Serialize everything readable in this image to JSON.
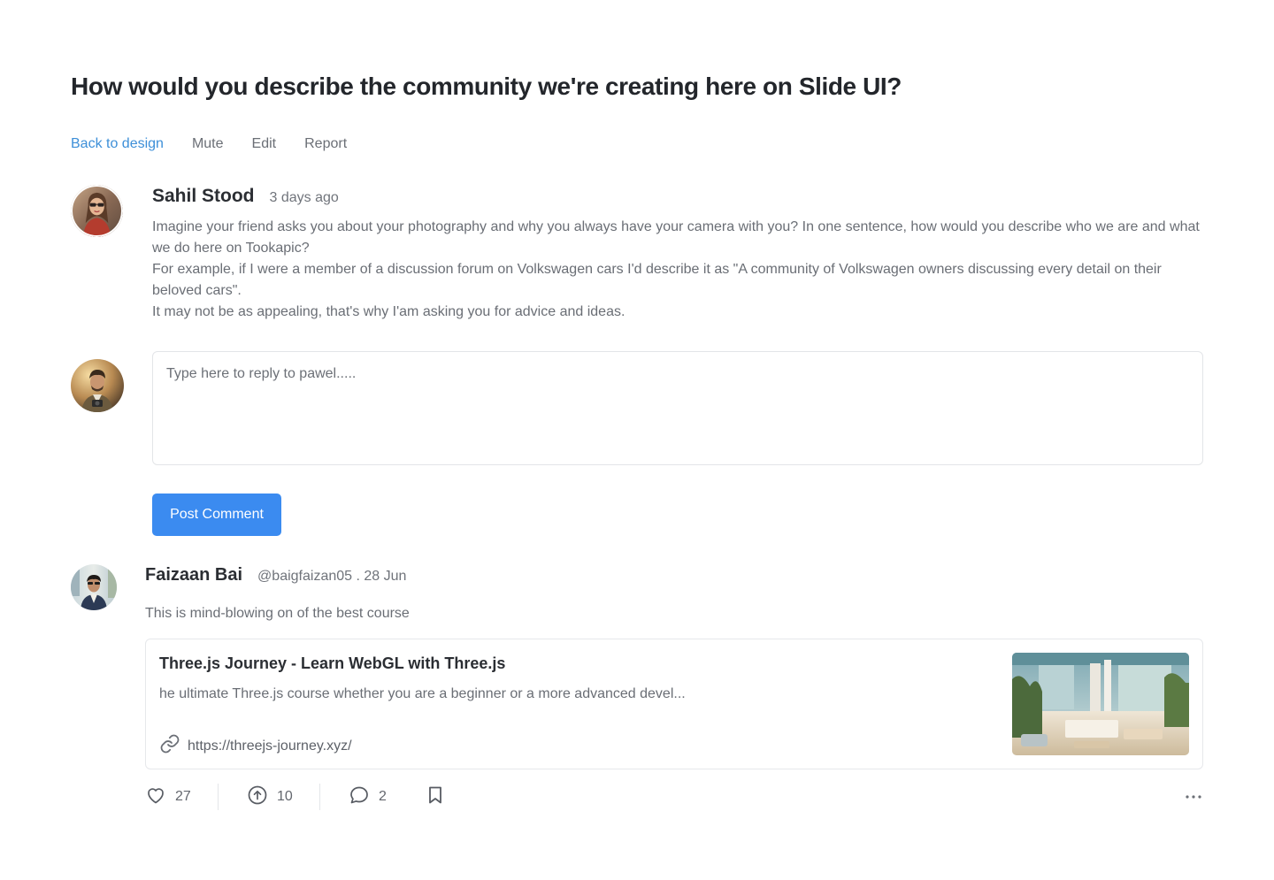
{
  "page": {
    "title": "How would you describe the community we're creating here on Slide UI?"
  },
  "actions": {
    "back": "Back to design",
    "mute": "Mute",
    "edit": "Edit",
    "report": "Report"
  },
  "post": {
    "author": "Sahil Stood",
    "time": "3 days ago",
    "paragraphs": [
      "Imagine your friend asks you about your photography and why you always have your camera with you? In one sentence, how would you describe who we are and what we do here on Tookapic?",
      "For example, if I were a member of a discussion forum on Volkswagen cars I'd describe it as \"A community of Volkswagen owners discussing every detail on their beloved cars\".",
      "It may not be as appealing, that's why I'am asking you for advice and ideas."
    ]
  },
  "reply": {
    "placeholder": "Type here to reply to pawel.....",
    "submit_label": "Post Comment"
  },
  "comment": {
    "author": "Faizaan Bai",
    "meta": "@baigfaizan05 . 28 Jun",
    "text": "This is mind-blowing on of the best course",
    "link": {
      "title": "Three.js Journey - Learn WebGL with Three.js",
      "description": "he ultimate Three.js course whether you are a beginner or a more advanced devel...",
      "url": "https://threejs-journey.xyz/"
    },
    "stats": {
      "likes": "27",
      "upvotes": "10",
      "replies": "2"
    }
  },
  "icons": {
    "like": "heart-icon",
    "upvote": "arrow-up-circle-icon",
    "reply": "chat-bubble-icon",
    "bookmark": "bookmark-icon",
    "link": "link-icon",
    "more": "more-horizontal-icon"
  },
  "colors": {
    "accent": "#3b8bf0",
    "link": "#3d8fd8",
    "text": "#23262b",
    "muted": "#6a6e75"
  }
}
